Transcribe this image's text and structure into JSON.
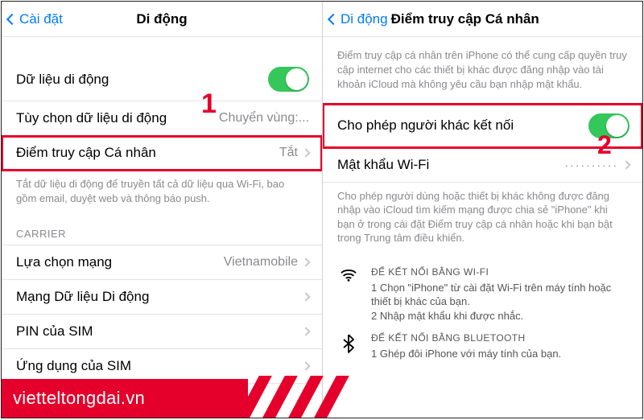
{
  "left": {
    "back": "Cài đặt",
    "title": "Di động",
    "rows": {
      "cellular_data": "Dữ liệu di động",
      "options": "Tùy chọn dữ liệu di động",
      "options_value": "Chuyển vùng:...",
      "hotspot": "Điểm truy cập Cá nhân",
      "hotspot_value": "Tắt",
      "footer": "Tắt dữ liệu di động để truyền tất cả dữ liệu qua Wi-Fi, bao gồm email, duyệt web và thông báo push.",
      "carrier": "CARRIER",
      "network_sel": "Lựa chọn mạng",
      "network_sel_value": "Vietnamobile",
      "cellular_net": "Mạng Dữ liệu Di động",
      "sim_pin": "PIN của SIM",
      "sim_apps": "Ứng dụng của SIM"
    }
  },
  "right": {
    "back": "Di động",
    "title": "Điểm truy cập Cá nhân",
    "header_note": "Điểm truy cập cá nhân trên iPhone có thể cung cấp quyền truy cập internet cho các thiết bị khác được đăng nhập vào tài khoản iCloud mà không yêu cầu bạn nhập mật khẩu.",
    "allow_others": "Cho phép người khác kết nối",
    "wifi_pw": "Mật khẩu Wi-Fi",
    "wifi_pw_value": "··········",
    "allow_note": "Cho phép người dùng hoặc thiết bị khác không được đăng nhập vào iCloud tìm kiếm mạng được chia sẻ \"iPhone\" khi bạn ở trong cài đặt Điểm truy cập cá nhân hoặc khi bạn bật trong Trung tâm điều khiển.",
    "wifi_title": "ĐỂ KẾT NỐI BẰNG WI-FI",
    "wifi_step1": "1 Chọn \"iPhone\" từ cài đặt Wi-Fi trên máy tính hoặc thiết bị khác của bạn.",
    "wifi_step2": "2 Nhập mật khẩu khi được nhắc.",
    "bt_title": "ĐỂ KẾT NỐI BẰNG BLUETOOTH",
    "bt_step1": "1 Ghép đôi iPhone với máy tính của bạn."
  },
  "callout1": "1",
  "callout2": "2",
  "watermark": "vietteltongdai.vn"
}
